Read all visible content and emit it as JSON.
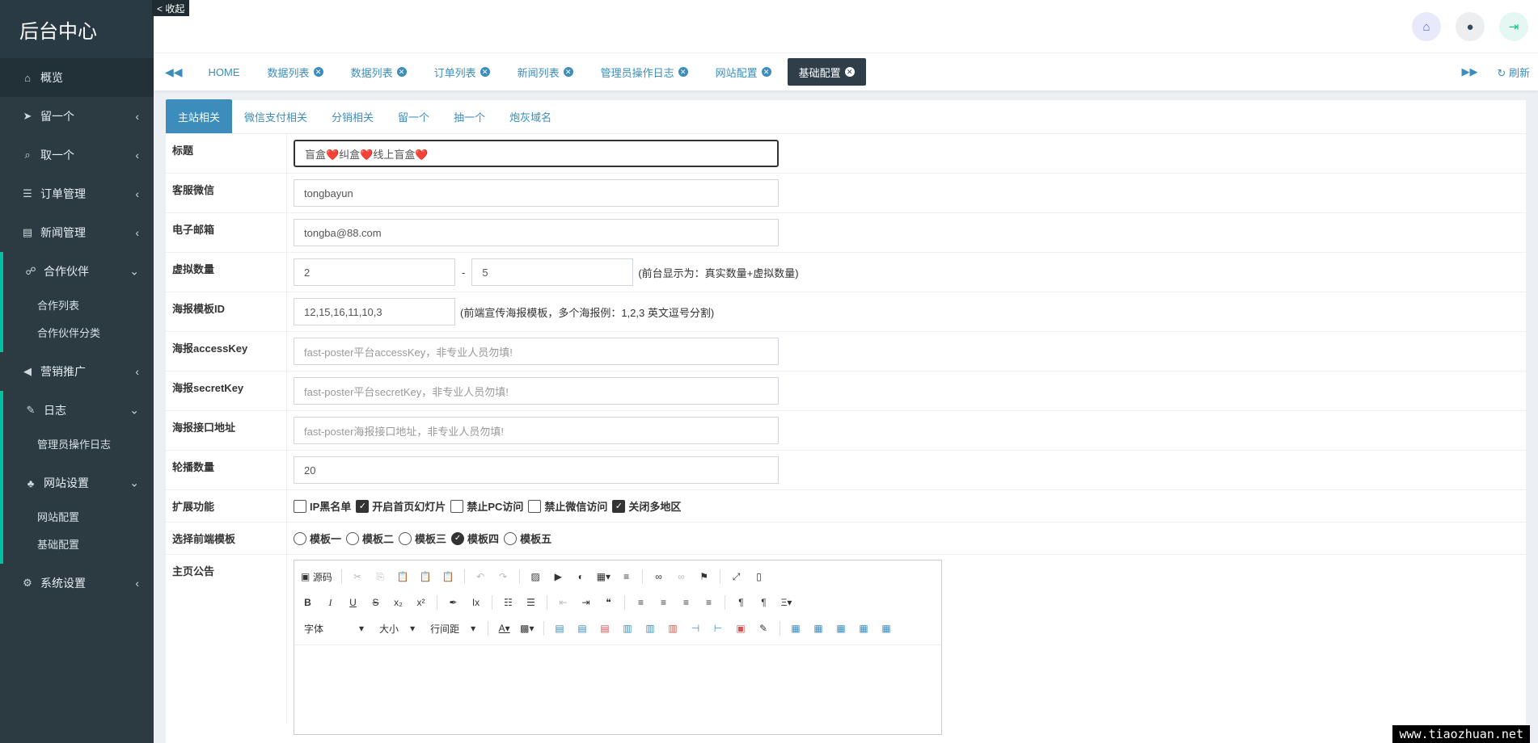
{
  "sidebar": {
    "brand": "后台中心",
    "collapse_label": "< 收起",
    "items": [
      {
        "label": "概览"
      },
      {
        "label": "留一个"
      },
      {
        "label": "取一个"
      },
      {
        "label": "订单管理"
      },
      {
        "label": "新闻管理"
      },
      {
        "label": "合作伙伴",
        "children": [
          "合作列表",
          "合作伙伴分类"
        ]
      },
      {
        "label": "营销推广"
      },
      {
        "label": "日志",
        "children": [
          "管理员操作日志"
        ]
      },
      {
        "label": "网站设置",
        "children": [
          "网站配置",
          "基础配置"
        ]
      },
      {
        "label": "系统设置"
      }
    ]
  },
  "tabs": {
    "items": [
      "HOME",
      "数据列表",
      "数据列表",
      "订单列表",
      "新闻列表",
      "管理员操作日志",
      "网站配置",
      "基础配置"
    ],
    "refresh_label": "刷新"
  },
  "subtabs": [
    "主站相关",
    "微信支付相关",
    "分销相关",
    "留一个",
    "抽一个",
    "炮灰域名"
  ],
  "form": {
    "title_label": "标题",
    "title_value": "盲盒❤️纠盒❤️线上盲盒❤️",
    "wechat_label": "客服微信",
    "wechat_value": "tongbayun",
    "email_label": "电子邮箱",
    "email_value": "tongba@88.com",
    "virtual_label": "虚拟数量",
    "virtual_min": "2",
    "virtual_sep": "-",
    "virtual_max": "5",
    "virtual_note": "(前台显示为：真实数量+虚拟数量)",
    "poster_id_label": "海报模板ID",
    "poster_id_value": "12,15,16,11,10,3",
    "poster_id_note": "(前端宣传海报模板，多个海报例：1,2,3 英文逗号分割)",
    "access_key_label": "海报accessKey",
    "access_key_placeholder": "fast-poster平台accessKey，非专业人员勿填!",
    "secret_key_label": "海报secretKey",
    "secret_key_placeholder": "fast-poster平台secretKey，非专业人员勿填!",
    "api_url_label": "海报接口地址",
    "api_url_placeholder": "fast-poster海报接口地址，非专业人员勿填!",
    "carousel_label": "轮播数量",
    "carousel_value": "20",
    "ext_label": "扩展功能",
    "ext_options": [
      {
        "label": "IP黑名单",
        "checked": false
      },
      {
        "label": "开启首页幻灯片",
        "checked": true
      },
      {
        "label": "禁止PC访问",
        "checked": false
      },
      {
        "label": "禁止微信访问",
        "checked": false
      },
      {
        "label": "关闭多地区",
        "checked": true
      }
    ],
    "template_label": "选择前端模板",
    "template_options": [
      {
        "label": "模板一",
        "selected": false
      },
      {
        "label": "模板二",
        "selected": false
      },
      {
        "label": "模板三",
        "selected": false
      },
      {
        "label": "模板四",
        "selected": true
      },
      {
        "label": "模板五",
        "selected": false
      }
    ],
    "notice_label": "主页公告"
  },
  "editor": {
    "source_label": "源码",
    "font_label": "字体",
    "size_label": "大小",
    "line_height_label": "行间距"
  },
  "watermark": "www.tiaozhuan.net"
}
